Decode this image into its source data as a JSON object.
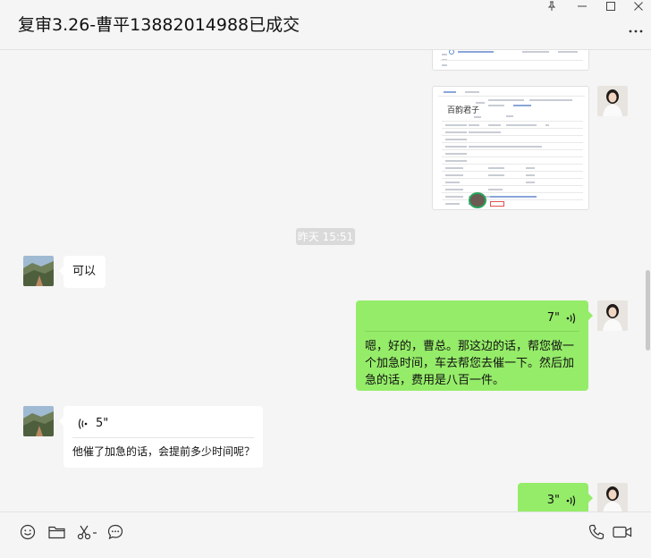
{
  "window": {
    "title": "复审3.26-曹平13882014988已成交"
  },
  "image_card": {
    "heading": "百韵君子"
  },
  "messages": [
    {
      "type": "timestamp",
      "text": "昨天 15:51"
    },
    {
      "type": "text",
      "side": "left",
      "text": "可以"
    },
    {
      "type": "voice",
      "side": "right",
      "duration": "7\"",
      "transcript": "嗯，好的，曹总。那这边的话，帮您做一个加急时间，车去帮您去催一下。然后加急的话，费用是八百一件。"
    },
    {
      "type": "voice",
      "side": "left",
      "duration": "5\"",
      "transcript": "他催了加急的话，会提前多少时间呢？"
    },
    {
      "type": "voice",
      "side": "right",
      "duration": "3\""
    }
  ],
  "colors": {
    "bubble_green": "#95ec69",
    "bubble_white": "#ffffff",
    "background": "#f5f5f5",
    "timestamp_bg": "#dadada"
  },
  "icons": {
    "pin": "pin-icon",
    "minimize": "minimize-icon",
    "maximize": "maximize-icon",
    "close": "close-icon",
    "more": "more-icon",
    "emoji": "emoji-icon",
    "folder": "folder-icon",
    "scissors": "scissors-icon",
    "chat_history": "chat-history-icon",
    "phone": "phone-icon",
    "video": "video-icon"
  }
}
